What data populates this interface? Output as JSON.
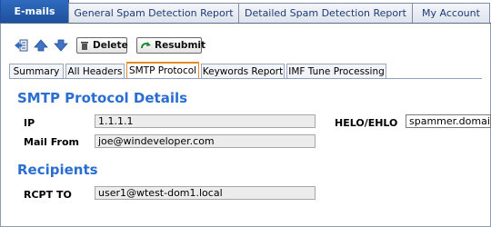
{
  "top_tabs": [
    "E-mails",
    "General Spam Detection Report",
    "Detailed Spam Detection Report",
    "My Account"
  ],
  "toolbar": {
    "back_icon": "back-to-list-icon",
    "up_icon": "arrow-up-icon",
    "down_icon": "arrow-down-icon",
    "delete_label": "Delete",
    "resubmit_label": "Resubmit"
  },
  "sub_tabs": [
    "Summary",
    "All Headers",
    "SMTP Protocol",
    "Keywords Report",
    "IMF Tune Processing"
  ],
  "active_sub_tab": "SMTP Protocol",
  "smtp": {
    "title": "SMTP Protocol Details",
    "ip_label": "IP",
    "ip_value": "1.1.1.1",
    "helo_label": "HELO/EHLO",
    "helo_value": "spammer.domain.",
    "mail_from_label": "Mail From",
    "mail_from_value": "joe@windeveloper.com"
  },
  "recipients": {
    "title": "Recipients",
    "rcpt_label": "RCPT TO",
    "rcpt_value": "user1@wtest-dom1.local"
  },
  "colors": {
    "accent": "#2a6ed1",
    "active_tab": "#1e4f9c",
    "active_subtab_border": "#e38d2a"
  }
}
